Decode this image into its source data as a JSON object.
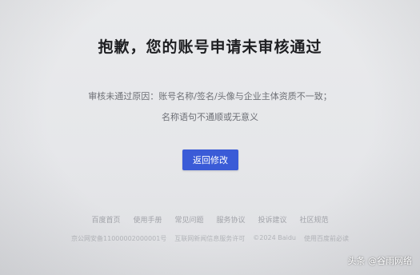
{
  "main": {
    "title": "抱歉，您的账号申请未审核通过",
    "reason_line1": "审核未通过原因：账号名称/签名/头像与企业主体资质不一致；",
    "reason_line2": "名称语句不通顺或无意义",
    "back_button": "返回修改"
  },
  "footer": {
    "links": [
      "百度首页",
      "使用手册",
      "常见问题",
      "服务协议",
      "投诉建议",
      "社区规范"
    ],
    "icp": "京公网安备11000002000001号",
    "license": "互联网新闻信息服务许可",
    "copyright": "©2024 Baidu",
    "must_read": "使用百度前必读"
  },
  "watermark": {
    "text": "头条 @谷雨网络"
  },
  "colors": {
    "background": "#e6e7ea",
    "button": "#3a5bd7",
    "title": "#1e1f22",
    "secondary_text": "#6e7076"
  }
}
